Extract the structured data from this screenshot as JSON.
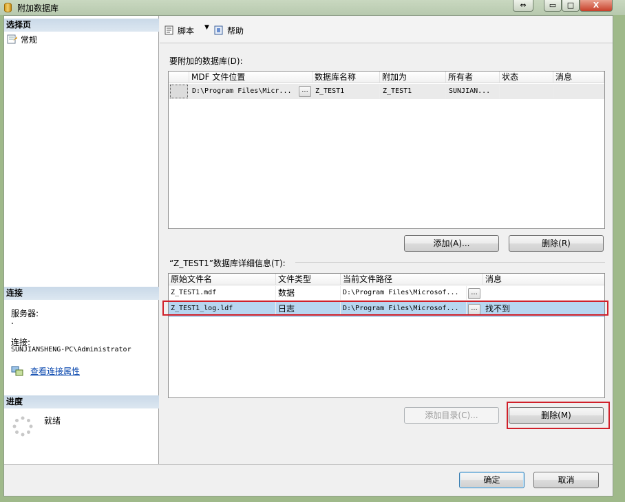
{
  "window": {
    "title": "附加数据库",
    "caption_buttons": {
      "restore": "⇔",
      "minimize": "▭",
      "maximize": "□",
      "close": "X"
    }
  },
  "left_pane": {
    "select_page": {
      "title": "选择页",
      "items": [
        {
          "label": "常规",
          "icon": "page-settings-icon"
        }
      ]
    },
    "connection": {
      "title": "连接",
      "server_label": "服务器:",
      "server_value": ".",
      "connection_label": "连接:",
      "connection_value": "SUNJIANSHENG-PC\\Administrator",
      "view_link": "查看连接属性"
    },
    "progress": {
      "title": "进度",
      "status": "就绪"
    }
  },
  "toolbar": {
    "script_label": "脚本",
    "help_label": "帮助"
  },
  "databases": {
    "label": "要附加的数据库(D):",
    "columns": [
      "MDF 文件位置",
      "数据库名称",
      "附加为",
      "所有者",
      "状态",
      "消息"
    ],
    "rows": [
      {
        "mdf": "D:\\Program Files\\Micr...",
        "name": "Z_TEST1",
        "attach_as": "Z_TEST1",
        "owner": "SUNJIAN...",
        "status": "",
        "message": ""
      }
    ],
    "add_button": "添加(A)...",
    "remove_button": "删除(R)"
  },
  "details": {
    "label": "“Z_TEST1”数据库详细信息(T):",
    "columns": [
      "原始文件名",
      "文件类型",
      "当前文件路径",
      "消息"
    ],
    "rows": [
      {
        "file": "Z_TEST1.mdf",
        "type": "数据",
        "path": "D:\\Program Files\\Microsof...",
        "message": ""
      },
      {
        "file": "Z_TEST1_log.ldf",
        "type": "日志",
        "path": "D:\\Program Files\\Microsof...",
        "message": "找不到"
      }
    ],
    "add_catalog_button": "添加目录(C)...",
    "remove_button": "删除(M)"
  },
  "footer": {
    "ok_button": "确定",
    "cancel_button": "取消"
  },
  "colors": {
    "highlight_box": "#d0202a",
    "selected_row": "#b7d6f0",
    "link": "#0645ad"
  }
}
